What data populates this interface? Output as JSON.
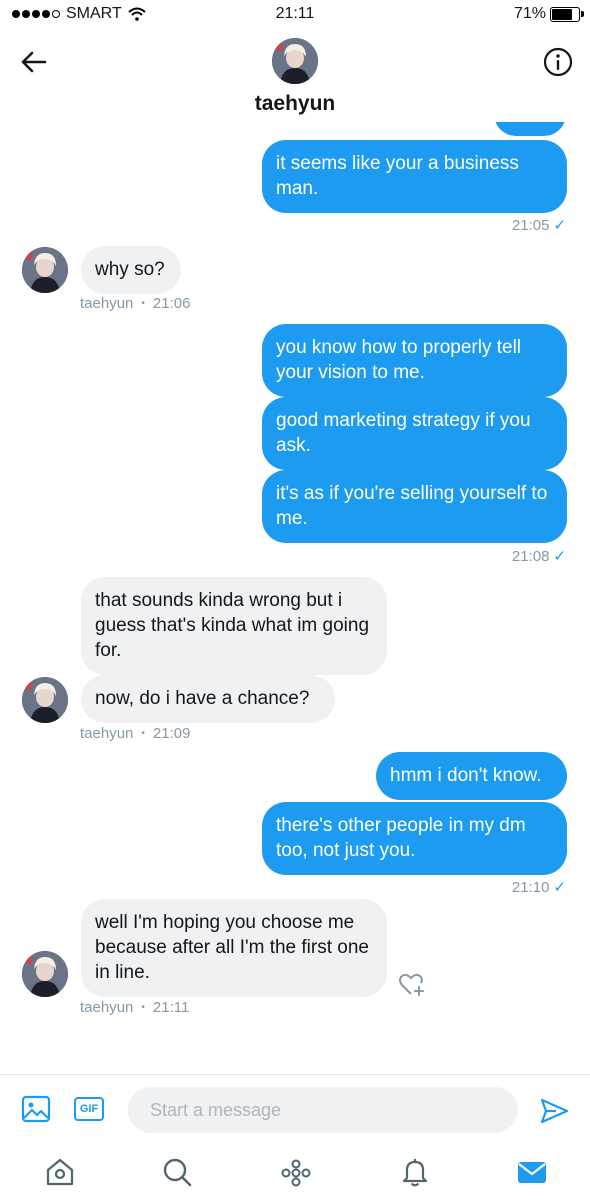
{
  "status_bar": {
    "carrier": "SMART",
    "time": "21:11",
    "battery": "71%"
  },
  "header": {
    "contact_name": "taehyun"
  },
  "messages": [
    {
      "text": "it seems like your a business man.",
      "side": "out"
    },
    {
      "text": "21:05",
      "kind": "stamp-out"
    },
    {
      "text": "why so?",
      "side": "in"
    },
    {
      "sender": "taehyun",
      "time": "21:06"
    },
    {
      "text": "you know how to properly tell your vision to me.",
      "side": "out"
    },
    {
      "text": "good marketing strategy if you ask.",
      "side": "out"
    },
    {
      "text": "it's as if you're selling yourself to me.",
      "side": "out"
    },
    {
      "text": "21:08",
      "kind": "stamp-out"
    },
    {
      "text": "that sounds kinda wrong but i guess that's kinda what im going for.",
      "side": "in"
    },
    {
      "text": "now, do i have a chance?",
      "side": "in"
    },
    {
      "sender": "taehyun",
      "time": "21:09"
    },
    {
      "text": "hmm i don't know.",
      "side": "out"
    },
    {
      "text": "there's other people in my dm too, not just you.",
      "side": "out"
    },
    {
      "text": "21:10",
      "kind": "stamp-out"
    },
    {
      "text": "well I'm hoping you choose me because after all I'm the first one in line.",
      "side": "in"
    },
    {
      "sender": "taehyun",
      "time": "21:11"
    }
  ],
  "composer": {
    "placeholder": "Start a message",
    "gif_label": "GIF"
  },
  "colors": {
    "accent": "#1d9bf0",
    "incoming_bubble": "#eff1f3",
    "meta_text": "#8899a6"
  },
  "icons": [
    "back-arrow-icon",
    "info-icon",
    "image-icon",
    "gif-icon",
    "send-icon",
    "heart-plus-icon",
    "home-icon",
    "search-icon",
    "spaces-icon",
    "bell-icon",
    "mail-icon"
  ]
}
